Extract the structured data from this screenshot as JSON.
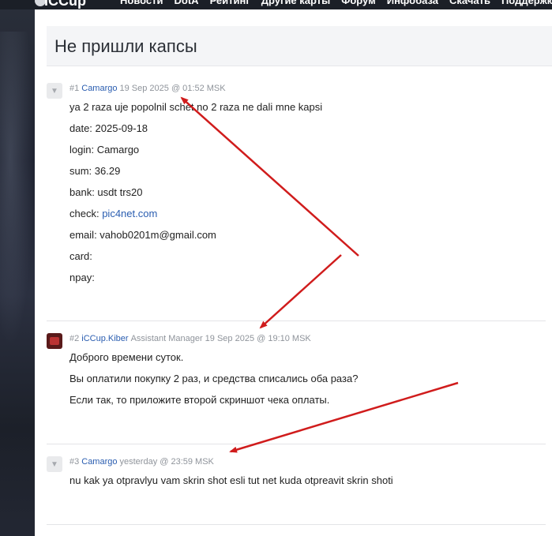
{
  "nav": {
    "logo": "ICCup",
    "items": [
      "Новости",
      "DotA",
      "Рейтинг",
      "Другие карты",
      "Форум",
      "Инфобаза",
      "Скачать",
      "Поддержка"
    ]
  },
  "page": {
    "title": "Не пришли капсы"
  },
  "posts": [
    {
      "num": "#1",
      "user": "Camargo",
      "role": "",
      "date": "19 Sep 2025 @ 01:52 MSK",
      "lines": [
        "ya 2 raza uje popolnil schet no 2 raza ne dali mne kapsi",
        "date: 2025-09-18",
        "login: Camargo",
        "sum: 36.29",
        "bank: usdt trs20",
        "email: vahob0201m@gmail.com",
        "card:",
        "npay:"
      ],
      "check_label": "check:",
      "check_link": "pic4net.com"
    },
    {
      "num": "#2",
      "user": "iCCup.Kiber",
      "role": "Assistant Manager",
      "date": "19 Sep 2025 @ 19:10 MSK",
      "lines": [
        "Доброго времени суток.",
        "Вы оплатили покупку 2 раз, и средства списались оба раза?",
        "Если так, то приложите второй скриншот чека оплаты."
      ]
    },
    {
      "num": "#3",
      "user": "Camargo",
      "role": "",
      "date": "yesterday @ 23:59 MSK",
      "lines": [
        "nu kak ya otpravlyu vam skrin shot esli tut net kuda otpreavit skrin shoti"
      ]
    }
  ],
  "colors": {
    "link": "#2a5db0",
    "arrow": "#d01c1c",
    "meta": "#8f949b"
  }
}
